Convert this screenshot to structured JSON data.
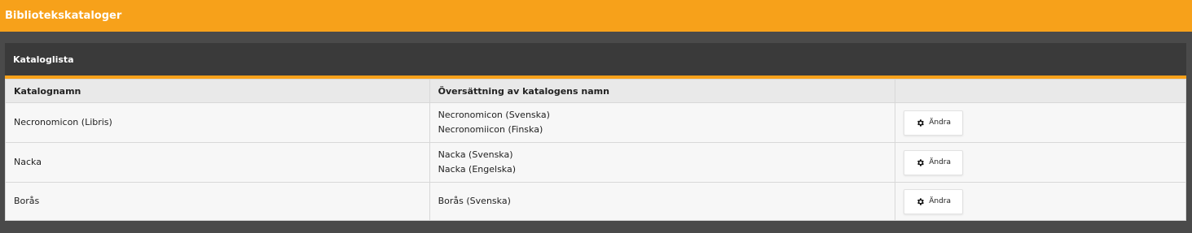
{
  "header": {
    "title": "Bibliotekskataloger"
  },
  "panel": {
    "title": "Kataloglista"
  },
  "table": {
    "columns": [
      "Katalognamn",
      "Översättning av katalogens namn",
      ""
    ],
    "rows": [
      {
        "name": "Necronomicon (Libris)",
        "translations": [
          "Necronomicon (Svenska)",
          "Necronomiicon (Finska)"
        ],
        "action_label": "Ändra"
      },
      {
        "name": "Nacka",
        "translations": [
          "Nacka (Svenska)",
          "Nacka (Engelska)"
        ],
        "action_label": "Ändra"
      },
      {
        "name": "Borås",
        "translations": [
          "Borås (Svenska)"
        ],
        "action_label": "Ändra"
      }
    ]
  },
  "icons": {
    "action_icon": "gear-icon"
  },
  "colors": {
    "accent": "#f7a11a",
    "panel_header": "#3a3a3a",
    "background": "#4a4a4a"
  }
}
